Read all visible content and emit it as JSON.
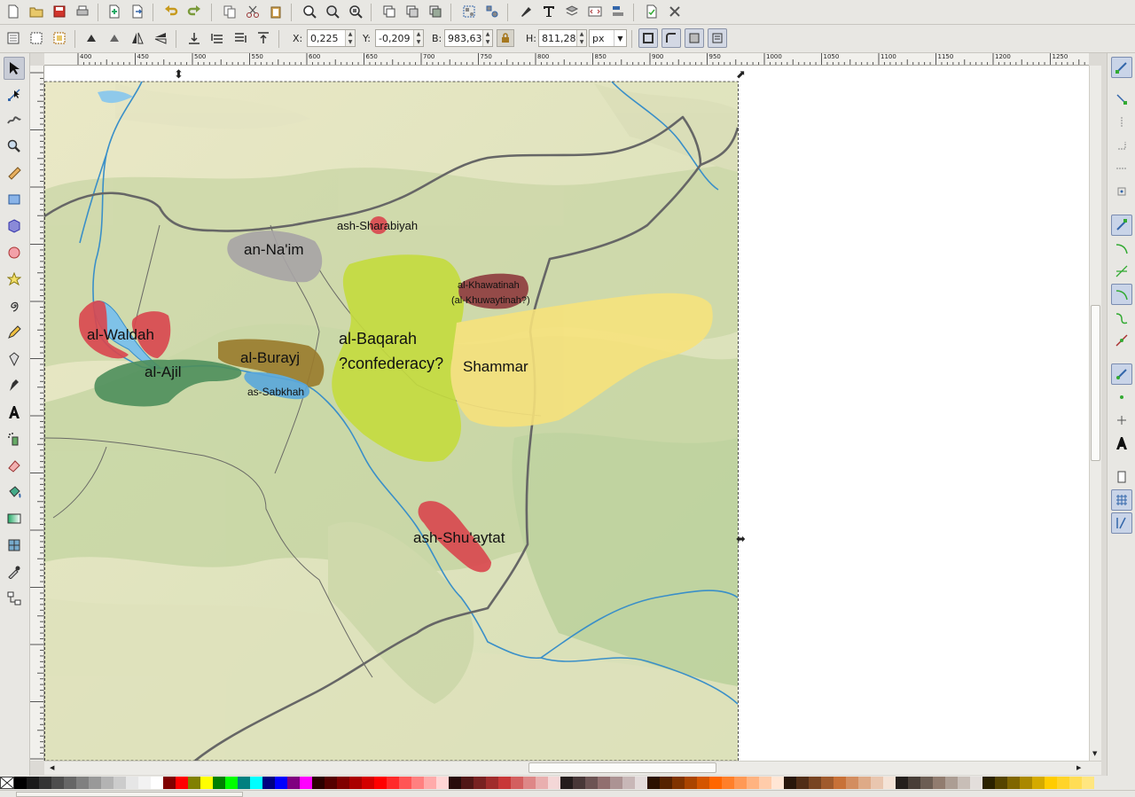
{
  "toolbar_top": {
    "icons": [
      "new-document-icon",
      "open-file-icon",
      "save-icon",
      "print-icon",
      "import-icon",
      "export-icon",
      "undo-icon",
      "redo-icon",
      "copy-icon",
      "cut-icon",
      "paste-icon",
      "zoom-selection-icon",
      "zoom-drawing-icon",
      "zoom-page-icon",
      "duplicate-icon",
      "clone-icon",
      "unlink-clone-icon",
      "group-icon",
      "ungroup-icon",
      "fill-stroke-icon",
      "text-font-icon",
      "layers-icon",
      "xml-editor-icon",
      "align-distribute-icon",
      "document-properties-icon",
      "preferences-icon"
    ]
  },
  "toolbar_controls": {
    "x_label": "X:",
    "x_value": "0,225",
    "y_label": "Y:",
    "y_value": "-0,209",
    "w_label": "B:",
    "w_value": "983,635",
    "h_label": "H:",
    "h_value": "811,287",
    "unit": "px"
  },
  "hruler": {
    "ticks": [
      "400",
      "450",
      "500",
      "550",
      "600",
      "650",
      "700",
      "750",
      "800",
      "850",
      "900",
      "950",
      "1000",
      "1050",
      "1100",
      "1150",
      "1200",
      "1250"
    ]
  },
  "map_labels": {
    "an_naim": "an-Na'im",
    "ash_sharabiyah": "ash-Sharabiyah",
    "al_khawatinah_1": "al-Khawatinah",
    "al_khawatinah_2": "(al-Khuwaytinah?)",
    "al_baqarah_1": "al-Baqarah",
    "al_baqarah_2": "?confederacy?",
    "shammar": "Shammar",
    "al_waldah": "al-Waldah",
    "al_burayj": "al-Burayj",
    "al_ajil": "al-Ajil",
    "as_sabkhah": "as-Sabkhah",
    "ash_shuaytat": "ash-Shu'aytat"
  },
  "colors": {
    "region_red": "#d9464e",
    "region_gray": "#a8a4a6",
    "region_lime": "#c5dc3e",
    "region_yellow": "#f6e27c",
    "region_darkred": "#8e3b3e",
    "region_olive": "#9a7b2c",
    "region_green": "#4e8f5c",
    "region_blue": "#5aa8dc",
    "river": "#3a8fc8",
    "border": "#666666"
  },
  "palette": [
    "#000000",
    "#1a1a1a",
    "#333333",
    "#4d4d4d",
    "#666666",
    "#808080",
    "#999999",
    "#b3b3b3",
    "#cccccc",
    "#e6e6e6",
    "#f2f2f2",
    "#ffffff",
    "#800000",
    "#ff0000",
    "#808000",
    "#ffff00",
    "#008000",
    "#00ff00",
    "#008080",
    "#00ffff",
    "#000080",
    "#0000ff",
    "#800080",
    "#ff00ff",
    "#2b0000",
    "#550000",
    "#800000",
    "#aa0000",
    "#d40000",
    "#ff0000",
    "#ff2a2a",
    "#ff5555",
    "#ff8080",
    "#ffaaaa",
    "#ffd5d5",
    "#280b0b",
    "#501616",
    "#782121",
    "#a02c2c",
    "#c83737",
    "#d35f5f",
    "#de8787",
    "#e9afaf",
    "#f4d7d7",
    "#241c1c",
    "#483737",
    "#6c5353",
    "#916f6f",
    "#ac9393",
    "#c8b7b7",
    "#e3dbdb",
    "#2b1100",
    "#552200",
    "#803300",
    "#aa4400",
    "#d45500",
    "#ff6600",
    "#ff7f2a",
    "#ff9955",
    "#ffb380",
    "#ffccaa",
    "#ffe6d5",
    "#28170b",
    "#502d16",
    "#784421",
    "#a05a2c",
    "#c87137",
    "#d38d5f",
    "#deaa87",
    "#e9c6af",
    "#f4e3d7",
    "#241f1c",
    "#483e37",
    "#6c5d53",
    "#917c6f",
    "#ac9d93",
    "#c8beb7",
    "#e3dedb",
    "#2b2200",
    "#554400",
    "#806600",
    "#aa8800",
    "#d4aa00",
    "#ffcc00",
    "#ffd42a",
    "#ffdd55",
    "#ffe680"
  ]
}
